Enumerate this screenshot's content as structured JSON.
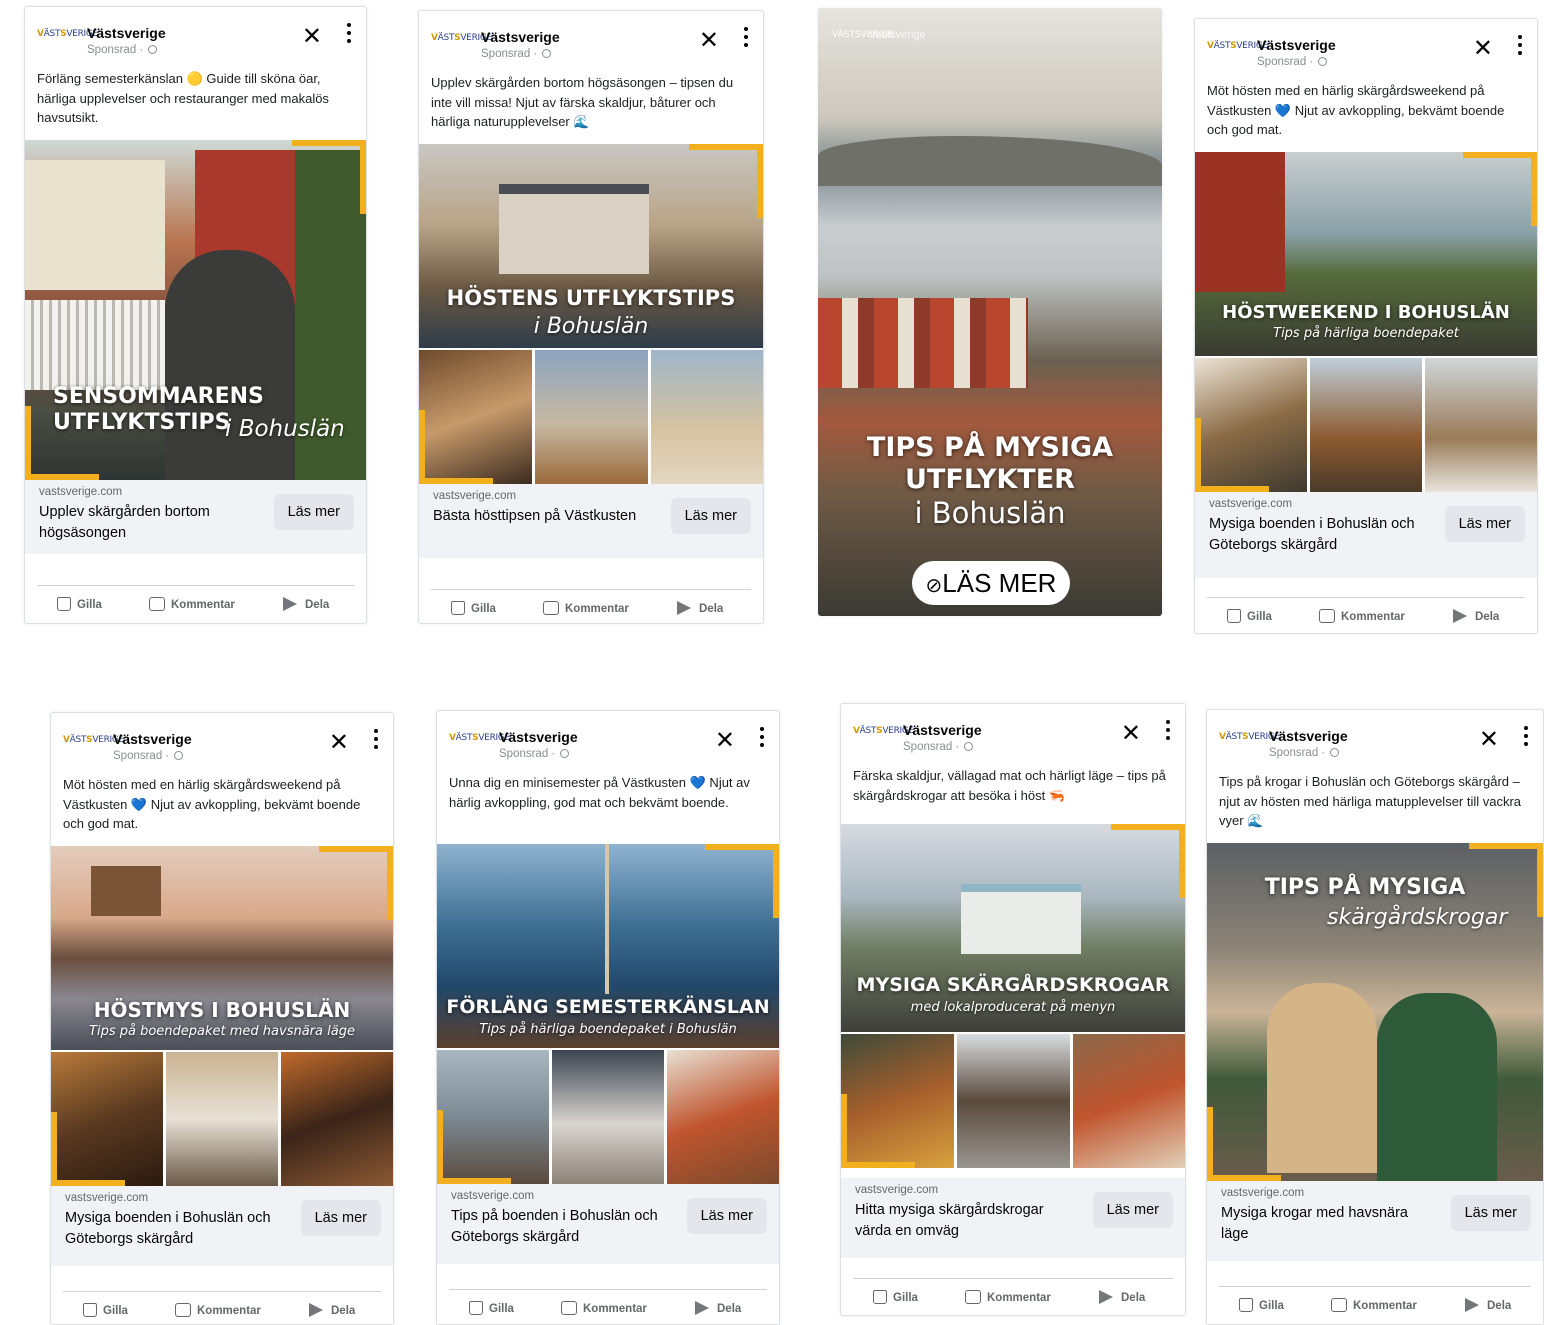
{
  "colors": {
    "accent": "#f2b01e",
    "brand_blue": "#2a3f8f",
    "link_bg": "#f0f2f5",
    "button_bg": "#e4e6eb",
    "muted": "#65676b"
  },
  "common": {
    "brand": "Västsverige",
    "sponsored": "Sponsrad ·",
    "logo_text": "VÄST SVERIGE",
    "domain": "vastsverige.com",
    "cta": "Läs mer",
    "close_icon": "close-icon",
    "like": "Gilla",
    "comment": "Kommentar",
    "share": "Dela"
  },
  "ads": [
    {
      "text": "Förläng semesterkänslan 🟡 Guide till sköna öar, härliga upplevelser och restauranger med makalös havsutsikt.",
      "headline": "SENSOMMARENS UTFLYKTSTIPS",
      "sub": "i Bohuslän",
      "link_title": "Upplev skärgården bortom högsäsongen"
    },
    {
      "text": "Upplev skärgården bortom högsäsongen – tipsen du inte vill missa! Njut av färska skaldjur, båturer och härliga naturupplevelser 🌊",
      "headline": "HÖSTENS UTFLYKTSTIPS",
      "sub": "i Bohuslän",
      "link_title": "Bästa hösttipsen på Västkusten"
    },
    {
      "story_brand": "vastsverige",
      "headline_l1": "TIPS PÅ MYSIGA",
      "headline_l2": "UTFLYKTER",
      "sub": "i Bohuslän",
      "cta": "LÄS MER"
    },
    {
      "text": "Möt hösten med en härlig skärgårdsweekend på Västkusten 💙 Njut av avkoppling, bekvämt boende och god mat.",
      "headline": "HÖSTWEEKEND I BOHUSLÄN",
      "sub": "Tips på härliga boendepaket",
      "link_title": "Mysiga boenden i Bohuslän och Göteborgs skärgård"
    },
    {
      "text": "Möt hösten med en härlig skärgårdsweekend på Västkusten 💙 Njut av avkoppling, bekvämt boende och god mat.",
      "headline": "HÖSTMYS I BOHUSLÄN",
      "sub": "Tips på boendepaket med havsnära läge",
      "link_title": "Mysiga boenden i Bohuslän och Göteborgs skärgård"
    },
    {
      "text": "Unna dig en minisemester på Västkusten 💙 Njut av härlig avkoppling, god mat och bekvämt boende.",
      "headline": "FÖRLÄNG SEMESTERKÄNSLAN",
      "sub": "Tips på härliga boendepaket i Bohuslän",
      "link_title": "Tips på boenden i Bohuslän och Göteborgs skärgård"
    },
    {
      "text": "Färska skaldjur, vällagad mat och härligt läge – tips på skärgårdskrogar att besöka i höst 🦐",
      "headline": "MYSIGA SKÄRGÅRDSKROGAR",
      "sub": "med lokalproducerat på menyn",
      "link_title": "Hitta mysiga skärgårdskrogar värda en omväg"
    },
    {
      "text": "Tips på krogar i Bohuslän och Göteborgs skärgård – njut av hösten med härliga matupplevelser till vackra vyer 🌊",
      "headline": "TIPS PÅ MYSIGA",
      "sub": "skärgårdskrogar",
      "link_title": "Mysiga krogar med havsnära läge"
    }
  ]
}
